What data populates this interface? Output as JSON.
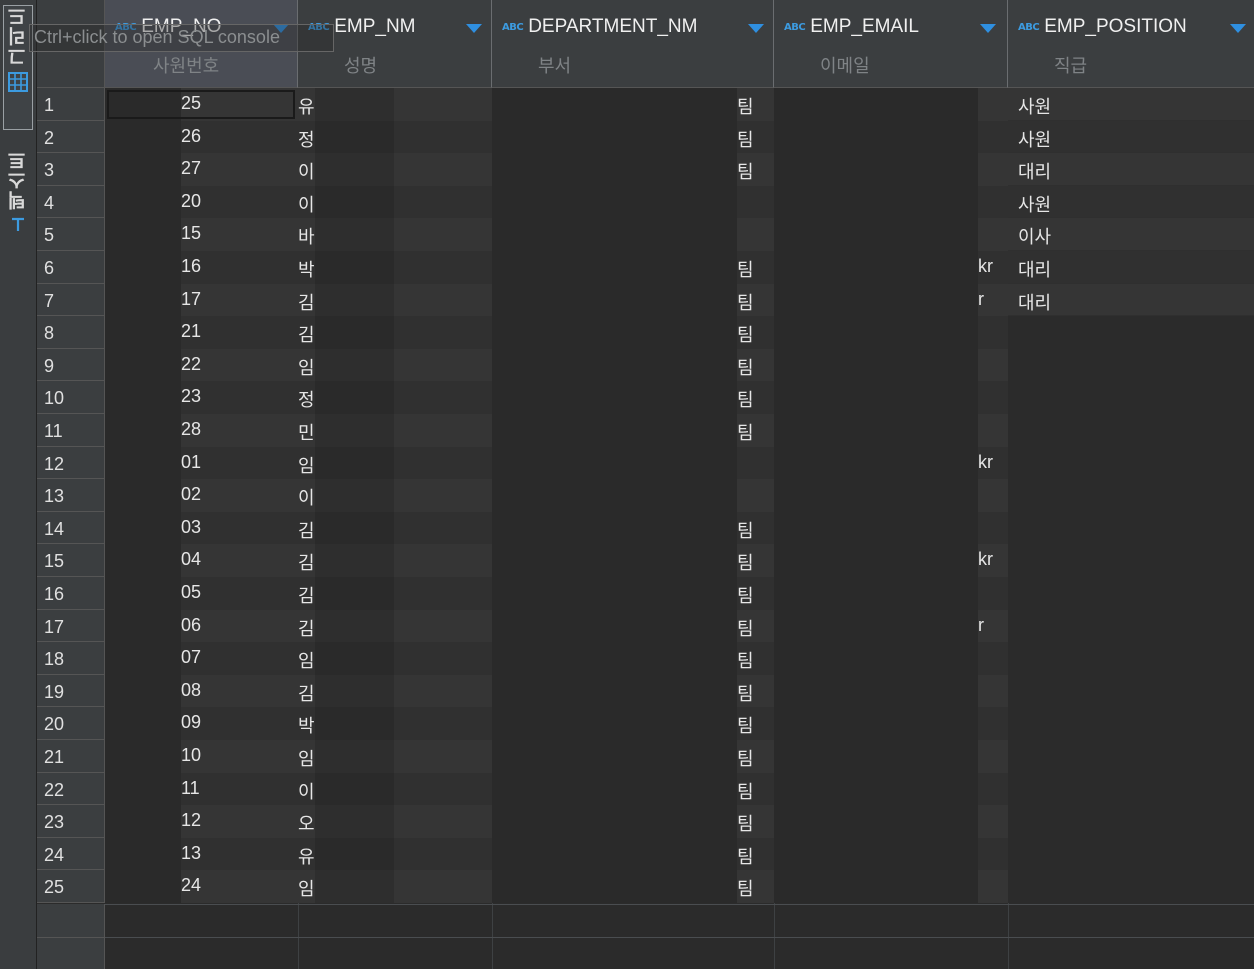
{
  "side_tabs": {
    "grid_label": "그리드",
    "text_label": "텍스트"
  },
  "tooltip": "Ctrl+click to open SQL console",
  "columns": [
    {
      "name": "EMP_NO",
      "label": "사원번호",
      "type_icon": "ABC"
    },
    {
      "name": "EMP_NM",
      "label": "성명",
      "type_icon": "ABC"
    },
    {
      "name": "DEPARTMENT_NM",
      "label": "부서",
      "type_icon": "ABC"
    },
    {
      "name": "EMP_EMAIL",
      "label": "이메일",
      "type_icon": "ABC"
    },
    {
      "name": "EMP_POSITION",
      "label": "직급",
      "type_icon": "ABC"
    }
  ],
  "rows": [
    {
      "n": "1",
      "no": "25",
      "nm": "유",
      "dep": "",
      "dep_end": "팀",
      "email_end": "",
      "pos": "사원"
    },
    {
      "n": "2",
      "no": "26",
      "nm": "정",
      "dep": "",
      "dep_end": "팀",
      "email_end": "",
      "pos": "사원"
    },
    {
      "n": "3",
      "no": "27",
      "nm": "이",
      "dep": "",
      "dep_end": "팀",
      "email_end": "",
      "pos": "대리"
    },
    {
      "n": "4",
      "no": "20",
      "nm": "이",
      "dep": "",
      "dep_end": "",
      "email_end": "",
      "pos": "사원"
    },
    {
      "n": "5",
      "no": "15",
      "nm": "바",
      "dep": "",
      "dep_end": "",
      "email_end": "",
      "pos": "이사"
    },
    {
      "n": "6",
      "no": "16",
      "nm": "박",
      "dep": "",
      "dep_end": "팀",
      "email_end": "kr",
      "pos": "대리"
    },
    {
      "n": "7",
      "no": "17",
      "nm": "김",
      "dep": "",
      "dep_end": "팀",
      "email_end": "r",
      "pos": "대리"
    },
    {
      "n": "8",
      "no": "21",
      "nm": "김",
      "dep": "",
      "dep_end": "팀",
      "email_end": "",
      "pos": ""
    },
    {
      "n": "9",
      "no": "22",
      "nm": "임",
      "dep": "",
      "dep_end": "팀",
      "email_end": "",
      "pos": ""
    },
    {
      "n": "10",
      "no": "23",
      "nm": "정",
      "dep": "",
      "dep_end": "팀",
      "email_end": "",
      "pos": ""
    },
    {
      "n": "11",
      "no": "28",
      "nm": "민",
      "dep": "",
      "dep_end": "팀",
      "email_end": "",
      "pos": ""
    },
    {
      "n": "12",
      "no": "01",
      "nm": "임",
      "dep": "",
      "dep_end": "",
      "email_end": "kr",
      "pos": ""
    },
    {
      "n": "13",
      "no": "02",
      "nm": "이",
      "dep": "",
      "dep_end": "",
      "email_end": "",
      "pos": ""
    },
    {
      "n": "14",
      "no": "03",
      "nm": "김",
      "dep": "",
      "dep_end": "팀",
      "email_end": "",
      "pos": ""
    },
    {
      "n": "15",
      "no": "04",
      "nm": "김",
      "dep": "",
      "dep_end": "팀",
      "email_end": "kr",
      "pos": ""
    },
    {
      "n": "16",
      "no": "05",
      "nm": "김",
      "dep": "",
      "dep_end": "팀",
      "email_end": "",
      "pos": ""
    },
    {
      "n": "17",
      "no": "06",
      "nm": "김",
      "dep": "",
      "dep_end": "팀",
      "email_end": "r",
      "pos": ""
    },
    {
      "n": "18",
      "no": "07",
      "nm": "임",
      "dep": "",
      "dep_end": "팀",
      "email_end": "",
      "pos": ""
    },
    {
      "n": "19",
      "no": "08",
      "nm": "김",
      "dep": "",
      "dep_end": "팀",
      "email_end": "",
      "pos": ""
    },
    {
      "n": "20",
      "no": "09",
      "nm": "박",
      "dep": "",
      "dep_end": "팀",
      "email_end": "",
      "pos": ""
    },
    {
      "n": "21",
      "no": "10",
      "nm": "임",
      "dep": "",
      "dep_end": "팀",
      "email_end": "",
      "pos": ""
    },
    {
      "n": "22",
      "no": "11",
      "nm": "이",
      "dep": "",
      "dep_end": "팀",
      "email_end": "",
      "pos": ""
    },
    {
      "n": "23",
      "no": "12",
      "nm": "오",
      "dep": "",
      "dep_end": "팀",
      "email_end": "",
      "pos": ""
    },
    {
      "n": "24",
      "no": "13",
      "nm": "유",
      "dep": "",
      "dep_end": "팀",
      "email_end": "",
      "pos": ""
    },
    {
      "n": "25",
      "no": "24",
      "nm": "임",
      "dep": "",
      "dep_end": "팀",
      "email_end": "",
      "pos": ""
    }
  ],
  "colors": {
    "accent": "#2f8fe0",
    "abc_icon": "#3c9be0",
    "bg": "#2b2b2b",
    "header_bg": "#3b3e40"
  }
}
